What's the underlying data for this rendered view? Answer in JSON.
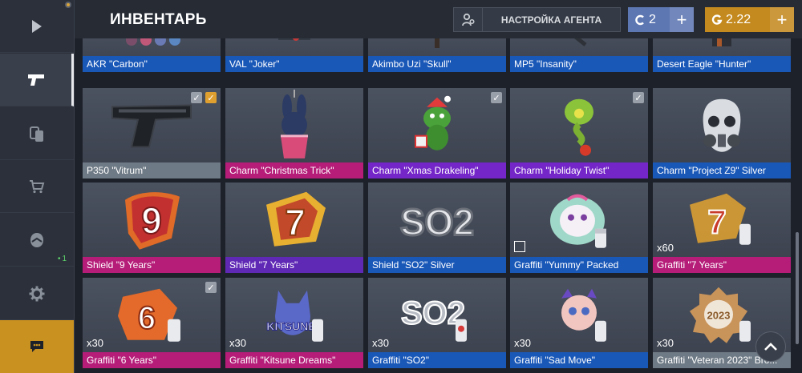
{
  "header": {
    "title": "ИНВЕНТАРЬ",
    "agent_button": "НАСТРОЙКА АГЕНТА",
    "silver": {
      "amount": "2",
      "plus": "+"
    },
    "gold": {
      "amount": "2.22",
      "plus": "+"
    }
  },
  "sidebar": {
    "items": [
      "play",
      "inventory",
      "cases",
      "market",
      "clan",
      "settings",
      "chat"
    ],
    "online_count": "1"
  },
  "colors": {
    "blue": "#1a58b8",
    "gray": "#6e7a85",
    "pink": "#b51d79",
    "purple": "#7426c8",
    "violet": "#5f28b5",
    "silver_currency": "#5d77b3",
    "gold_currency": "#c48a1f"
  },
  "rows": [
    {
      "items": [
        {
          "name": "AKR \"Carbon\"",
          "color": "blue",
          "icon": "akr-icon"
        },
        {
          "name": "VAL \"Joker\"",
          "color": "blue",
          "icon": "val-icon"
        },
        {
          "name": "Akimbo Uzi \"Skull\"",
          "color": "blue",
          "icon": "uzi-icon"
        },
        {
          "name": "MP5 \"Insanity\"",
          "color": "blue",
          "icon": "mp5-icon"
        },
        {
          "name": "Desert Eagle \"Hunter\"",
          "color": "blue",
          "icon": "deagle-icon"
        }
      ]
    },
    {
      "items": [
        {
          "name": "P350 \"Vitrum\"",
          "color": "gray",
          "icon": "pistol-icon",
          "checks": [
            "w",
            "o"
          ]
        },
        {
          "name": "Charm \"Christmas Trick\"",
          "color": "pink",
          "icon": "bunny-charm-icon"
        },
        {
          "name": "Charm \"Xmas Drakeling\"",
          "color": "purple",
          "icon": "dragon-charm-icon",
          "checks": [
            "w"
          ]
        },
        {
          "name": "Charm \"Holiday Twist\"",
          "color": "purple",
          "icon": "snake-charm-icon",
          "checks": [
            "w"
          ]
        },
        {
          "name": "Charm \"Project Z9\" Silver",
          "color": "blue",
          "icon": "gasmask-charm-icon"
        }
      ]
    },
    {
      "items": [
        {
          "name": "Shield \"9 Years\"",
          "color": "pink",
          "icon": "shield-9-icon"
        },
        {
          "name": "Shield \"7 Years\"",
          "color": "violet",
          "icon": "shield-7-icon"
        },
        {
          "name": "Shield \"SO2\" Silver",
          "color": "blue",
          "icon": "shield-so2-icon"
        },
        {
          "name": "Graffiti \"Yummy\" Packed",
          "color": "blue",
          "icon": "graffiti-yummy-icon",
          "packed": true
        },
        {
          "name": "Graffiti \"7 Years\"",
          "color": "pink",
          "icon": "graffiti-7-icon",
          "qty": "x60"
        }
      ]
    },
    {
      "items": [
        {
          "name": "Graffiti \"6 Years\"",
          "color": "pink",
          "icon": "graffiti-6-icon",
          "qty": "x30",
          "checks": [
            "w"
          ]
        },
        {
          "name": "Graffiti \"Kitsune Dreams\"",
          "color": "pink",
          "icon": "graffiti-kitsune-icon",
          "qty": "x30"
        },
        {
          "name": "Graffiti \"SO2\"",
          "color": "blue",
          "icon": "graffiti-so2-icon",
          "qty": "x30"
        },
        {
          "name": "Graffiti \"Sad Move\"",
          "color": "blue",
          "icon": "graffiti-sadmove-icon",
          "qty": "x30"
        },
        {
          "name": "Graffiti \"Veteran 2023\" Bro...",
          "color": "gray",
          "icon": "graffiti-veteran-icon",
          "qty": "x30"
        }
      ]
    }
  ],
  "art_text": {
    "shield_9": "9",
    "shield_7": "7",
    "shield_so2": "SO2",
    "graffiti_so2": "SO2",
    "graffiti_kitsune": "KITSUNE",
    "graffiti_6": "6",
    "graffiti_7": "7",
    "graffiti_veteran_year": "2023"
  }
}
